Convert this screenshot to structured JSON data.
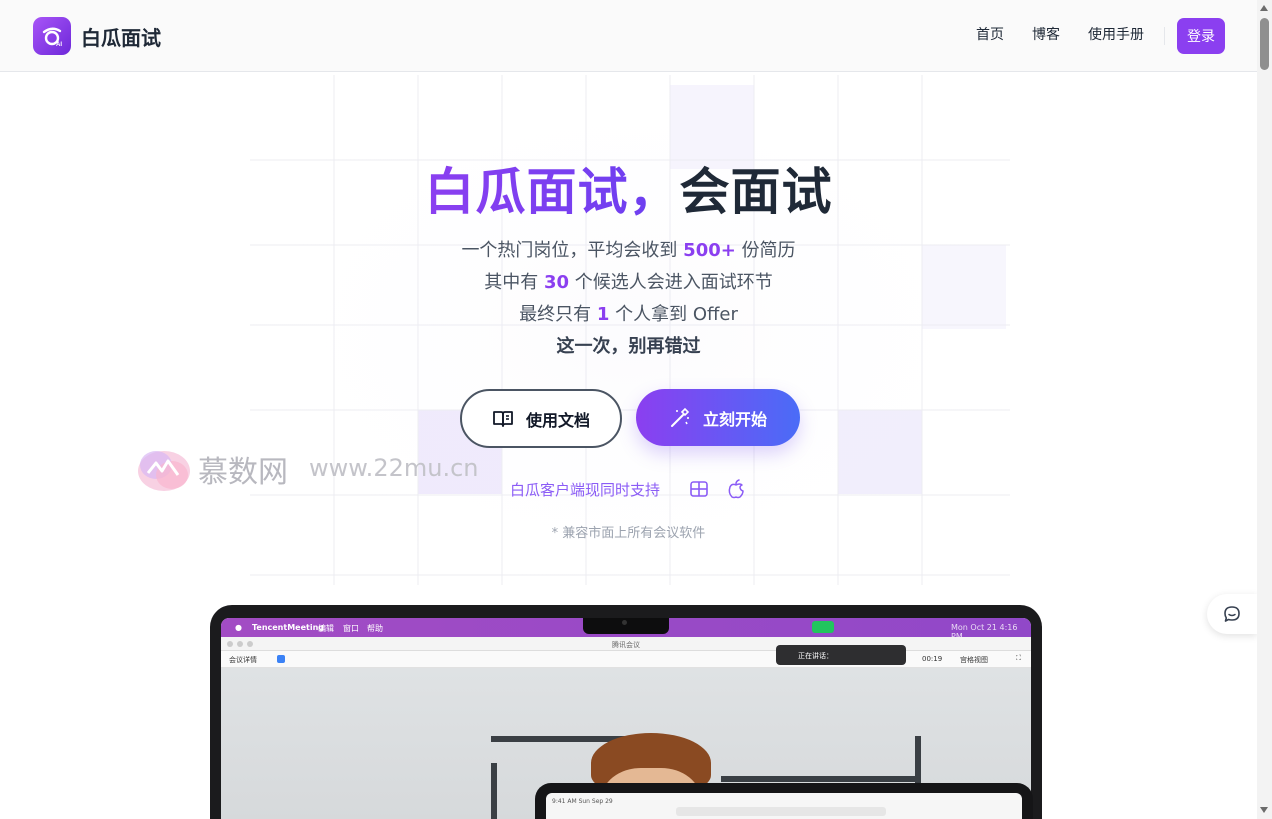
{
  "header": {
    "brand": "白瓜面试",
    "nav": [
      "首页",
      "博客",
      "使用手册"
    ],
    "login": "登录"
  },
  "hero": {
    "title_accent": "白瓜面试，",
    "title_rest": "会面试",
    "line1_pre": "一个热门岗位，平均会收到 ",
    "line1_num": "500+",
    "line1_post": " 份简历",
    "line2_pre": "其中有 ",
    "line2_num": "30",
    "line2_post": " 个候选人会进入面试环节",
    "line3_pre": "最终只有 ",
    "line3_num": "1",
    "line3_post": " 个人拿到 Offer",
    "line4": "这一次，别再错过",
    "btn_docs": "使用文档",
    "btn_start": "立刻开始",
    "support": "白瓜客户端现同时支持",
    "compat": "* 兼容市面上所有会议软件"
  },
  "watermark": {
    "text": "慕数网",
    "url": "www.22mu.cn"
  },
  "screenshot": {
    "app_name": "TencentMeeting",
    "menu": [
      "编辑",
      "窗口",
      "帮助"
    ],
    "window_title": "腾讯会议",
    "meeting_info": "会议详情",
    "speaking": "正在讲话：",
    "timer": "00:19",
    "view": "宫格视图",
    "clock": "Mon Oct 21  4:16 PM",
    "tablet_time": "9:41 AM  Sun Sep 29"
  },
  "colors": {
    "accent": "#8b3ff0",
    "gradient_end": "#4a6cf7"
  }
}
